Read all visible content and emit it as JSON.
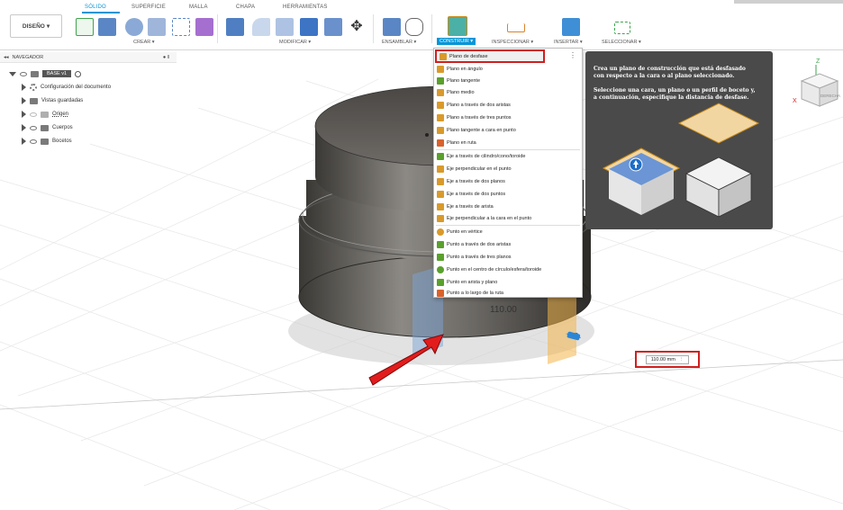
{
  "toolbar": {
    "design_button": "DISEÑO",
    "tabs": [
      "SÓLIDO",
      "SUPERFICIE",
      "MALLA",
      "CHAPA",
      "HERRAMIENTAS"
    ],
    "groups": {
      "crear": "CREAR ▾",
      "modificar": "MODIFICAR ▾",
      "ensamblar": "ENSAMBLAR ▾",
      "construir": "CONSTRUIR ▾",
      "inspeccionar": "INSPECCIONAR ▾",
      "insertar": "INSERTAR ▾",
      "seleccionar": "SELECCIONAR ▾"
    }
  },
  "browser": {
    "title": "NAVEGADOR",
    "root": "BASE v1",
    "items": [
      "Configuración del documento",
      "Vistas guardadas",
      "Origen",
      "Cuerpos",
      "Bocetos"
    ]
  },
  "construct_menu": {
    "items": [
      {
        "label": "Plano de desfase",
        "color": "#d99a2b"
      },
      {
        "label": "Plano en ángulo",
        "color": "#d99a2b"
      },
      {
        "label": "Plano tangente",
        "color": "#5aa02c"
      },
      {
        "label": "Plano medio",
        "color": "#d99a2b"
      },
      {
        "label": "Plano a través de dos aristas",
        "color": "#d99a2b"
      },
      {
        "label": "Plano a través de tres puntos",
        "color": "#d99a2b"
      },
      {
        "label": "Plano tangente a cara en punto",
        "color": "#d99a2b"
      },
      {
        "label": "Plano en ruta",
        "color": "#d9622b"
      },
      {
        "label": "Eje a través de cilindro/cono/toroide",
        "color": "#5aa02c"
      },
      {
        "label": "Eje perpendicular en el punto",
        "color": "#d99a2b"
      },
      {
        "label": "Eje a través de dos planos",
        "color": "#d99a2b"
      },
      {
        "label": "Eje a través de dos puntos",
        "color": "#d99a2b"
      },
      {
        "label": "Eje a través de arista",
        "color": "#d99a2b"
      },
      {
        "label": "Eje perpendicular a la cara en el punto",
        "color": "#d99a2b"
      },
      {
        "label": "Punto en vértice",
        "color": "#d99a2b"
      },
      {
        "label": "Punto a través de dos aristas",
        "color": "#5aa02c"
      },
      {
        "label": "Punto a través de tres planos",
        "color": "#5aa02c"
      },
      {
        "label": "Punto en el centro de círculo/esfera/toroide",
        "color": "#5aa02c"
      },
      {
        "label": "Punto en arista y plano",
        "color": "#5aa02c"
      },
      {
        "label": "Punto a lo largo de la ruta",
        "color": "#d9622b"
      }
    ]
  },
  "tooltip": {
    "line1": "Crea un plano de construcción que está desfasado",
    "line2": "con respecto a la cara o al plano seleccionado.",
    "line3": "Seleccione una cara, un plano o un perfil de boceto y,",
    "line4": "a continuación, especifique la distancia de desfase."
  },
  "dimension": {
    "value": "110.00 mm",
    "canvas_label": "110.00"
  },
  "nav_cube": {
    "front": "DERECHA",
    "axis_z": "Z",
    "axis_x": "X"
  },
  "colors": {
    "accent": "#0696d7",
    "highlight": "#d01f1f"
  }
}
